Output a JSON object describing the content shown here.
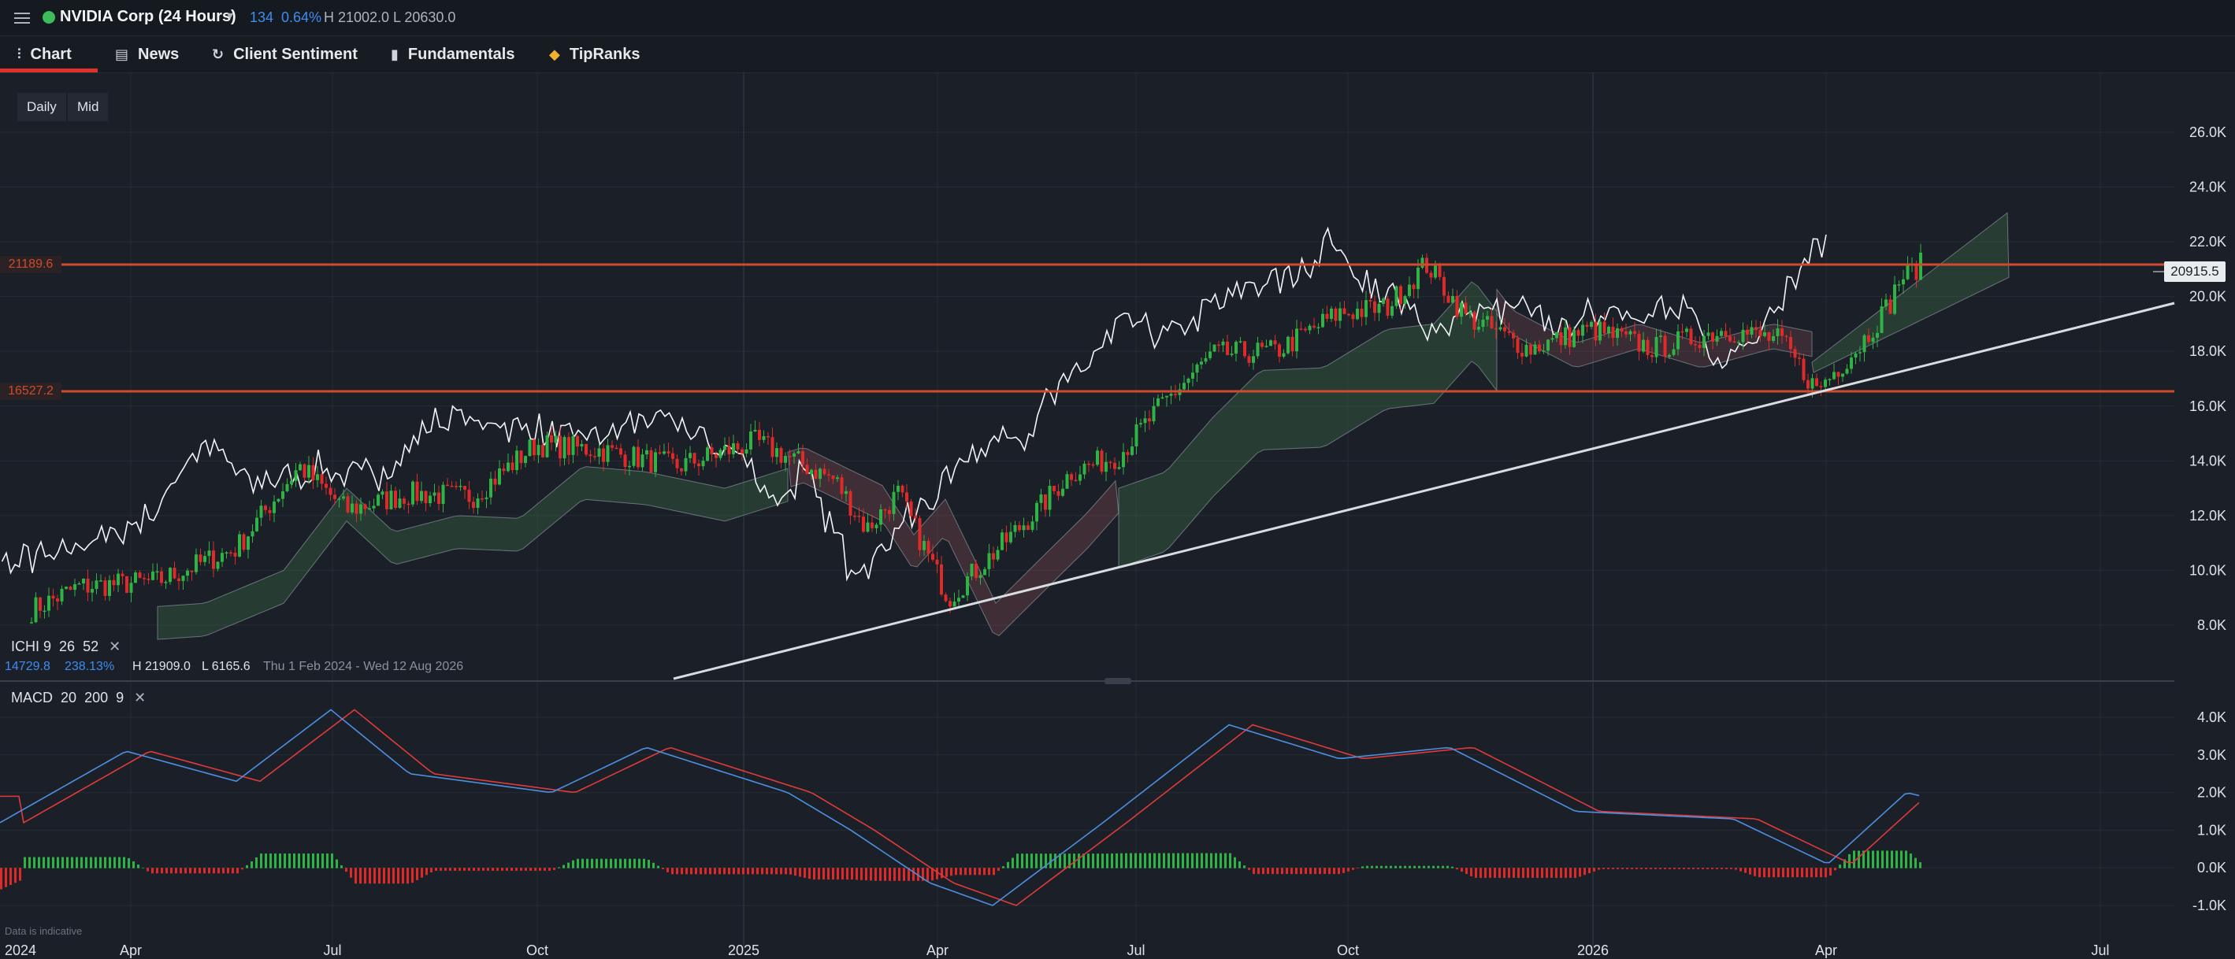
{
  "header": {
    "symbol": "NVIDIA Corp (24 Hours)",
    "change": "134",
    "change_pct": "0.64%",
    "high": "H 21002.0",
    "low": "L 20630.0"
  },
  "tabs": [
    {
      "label": "Chart",
      "icon": "chart-candles-icon",
      "active": true
    },
    {
      "label": "News",
      "icon": "newspaper-icon"
    },
    {
      "label": "Client Sentiment",
      "icon": "refresh-circle-icon"
    },
    {
      "label": "Fundamentals",
      "icon": "bar-chart-icon"
    },
    {
      "label": "TipRanks",
      "icon": "tipranks-logo-icon"
    }
  ],
  "timeframe": {
    "period": "Daily",
    "price_type": "Mid"
  },
  "price_levels": {
    "upper": "21189.6",
    "lower": "16527.2",
    "current": "20915.5"
  },
  "price_axis": [
    "26.0K",
    "24.0K",
    "22.0K",
    "20.0K",
    "18.0K",
    "16.0K",
    "14.0K",
    "12.0K",
    "10.0K",
    "8.0K"
  ],
  "macd_axis": [
    "4.0K",
    "3.0K",
    "2.0K",
    "1.0K",
    "0.0K",
    "-1.0K"
  ],
  "time_axis": [
    "2024",
    "Apr",
    "Jul",
    "Oct",
    "2025",
    "Apr",
    "Jul",
    "Oct",
    "2026",
    "Apr",
    "Jul"
  ],
  "ichimoku": {
    "label": "ICHI",
    "p1": "9",
    "p2": "26",
    "p3": "52"
  },
  "macd": {
    "label": "MACD",
    "p1": "20",
    "p2": "200",
    "p3": "9"
  },
  "range_info": {
    "value": "14729.8",
    "pct": "238.13%",
    "high": "H 21909.0",
    "low": "L 6165.6",
    "dates": "Thu 1 Feb 2024 - Wed 12 Aug 2026"
  },
  "footer": "Data is indicative",
  "colors": {
    "up": "#2fb344",
    "down": "#e02a2a",
    "accent": "#e0312d",
    "macd_line": "#4d8fe0",
    "signal_line": "#e03a3a",
    "level": "#d04a2b"
  }
}
